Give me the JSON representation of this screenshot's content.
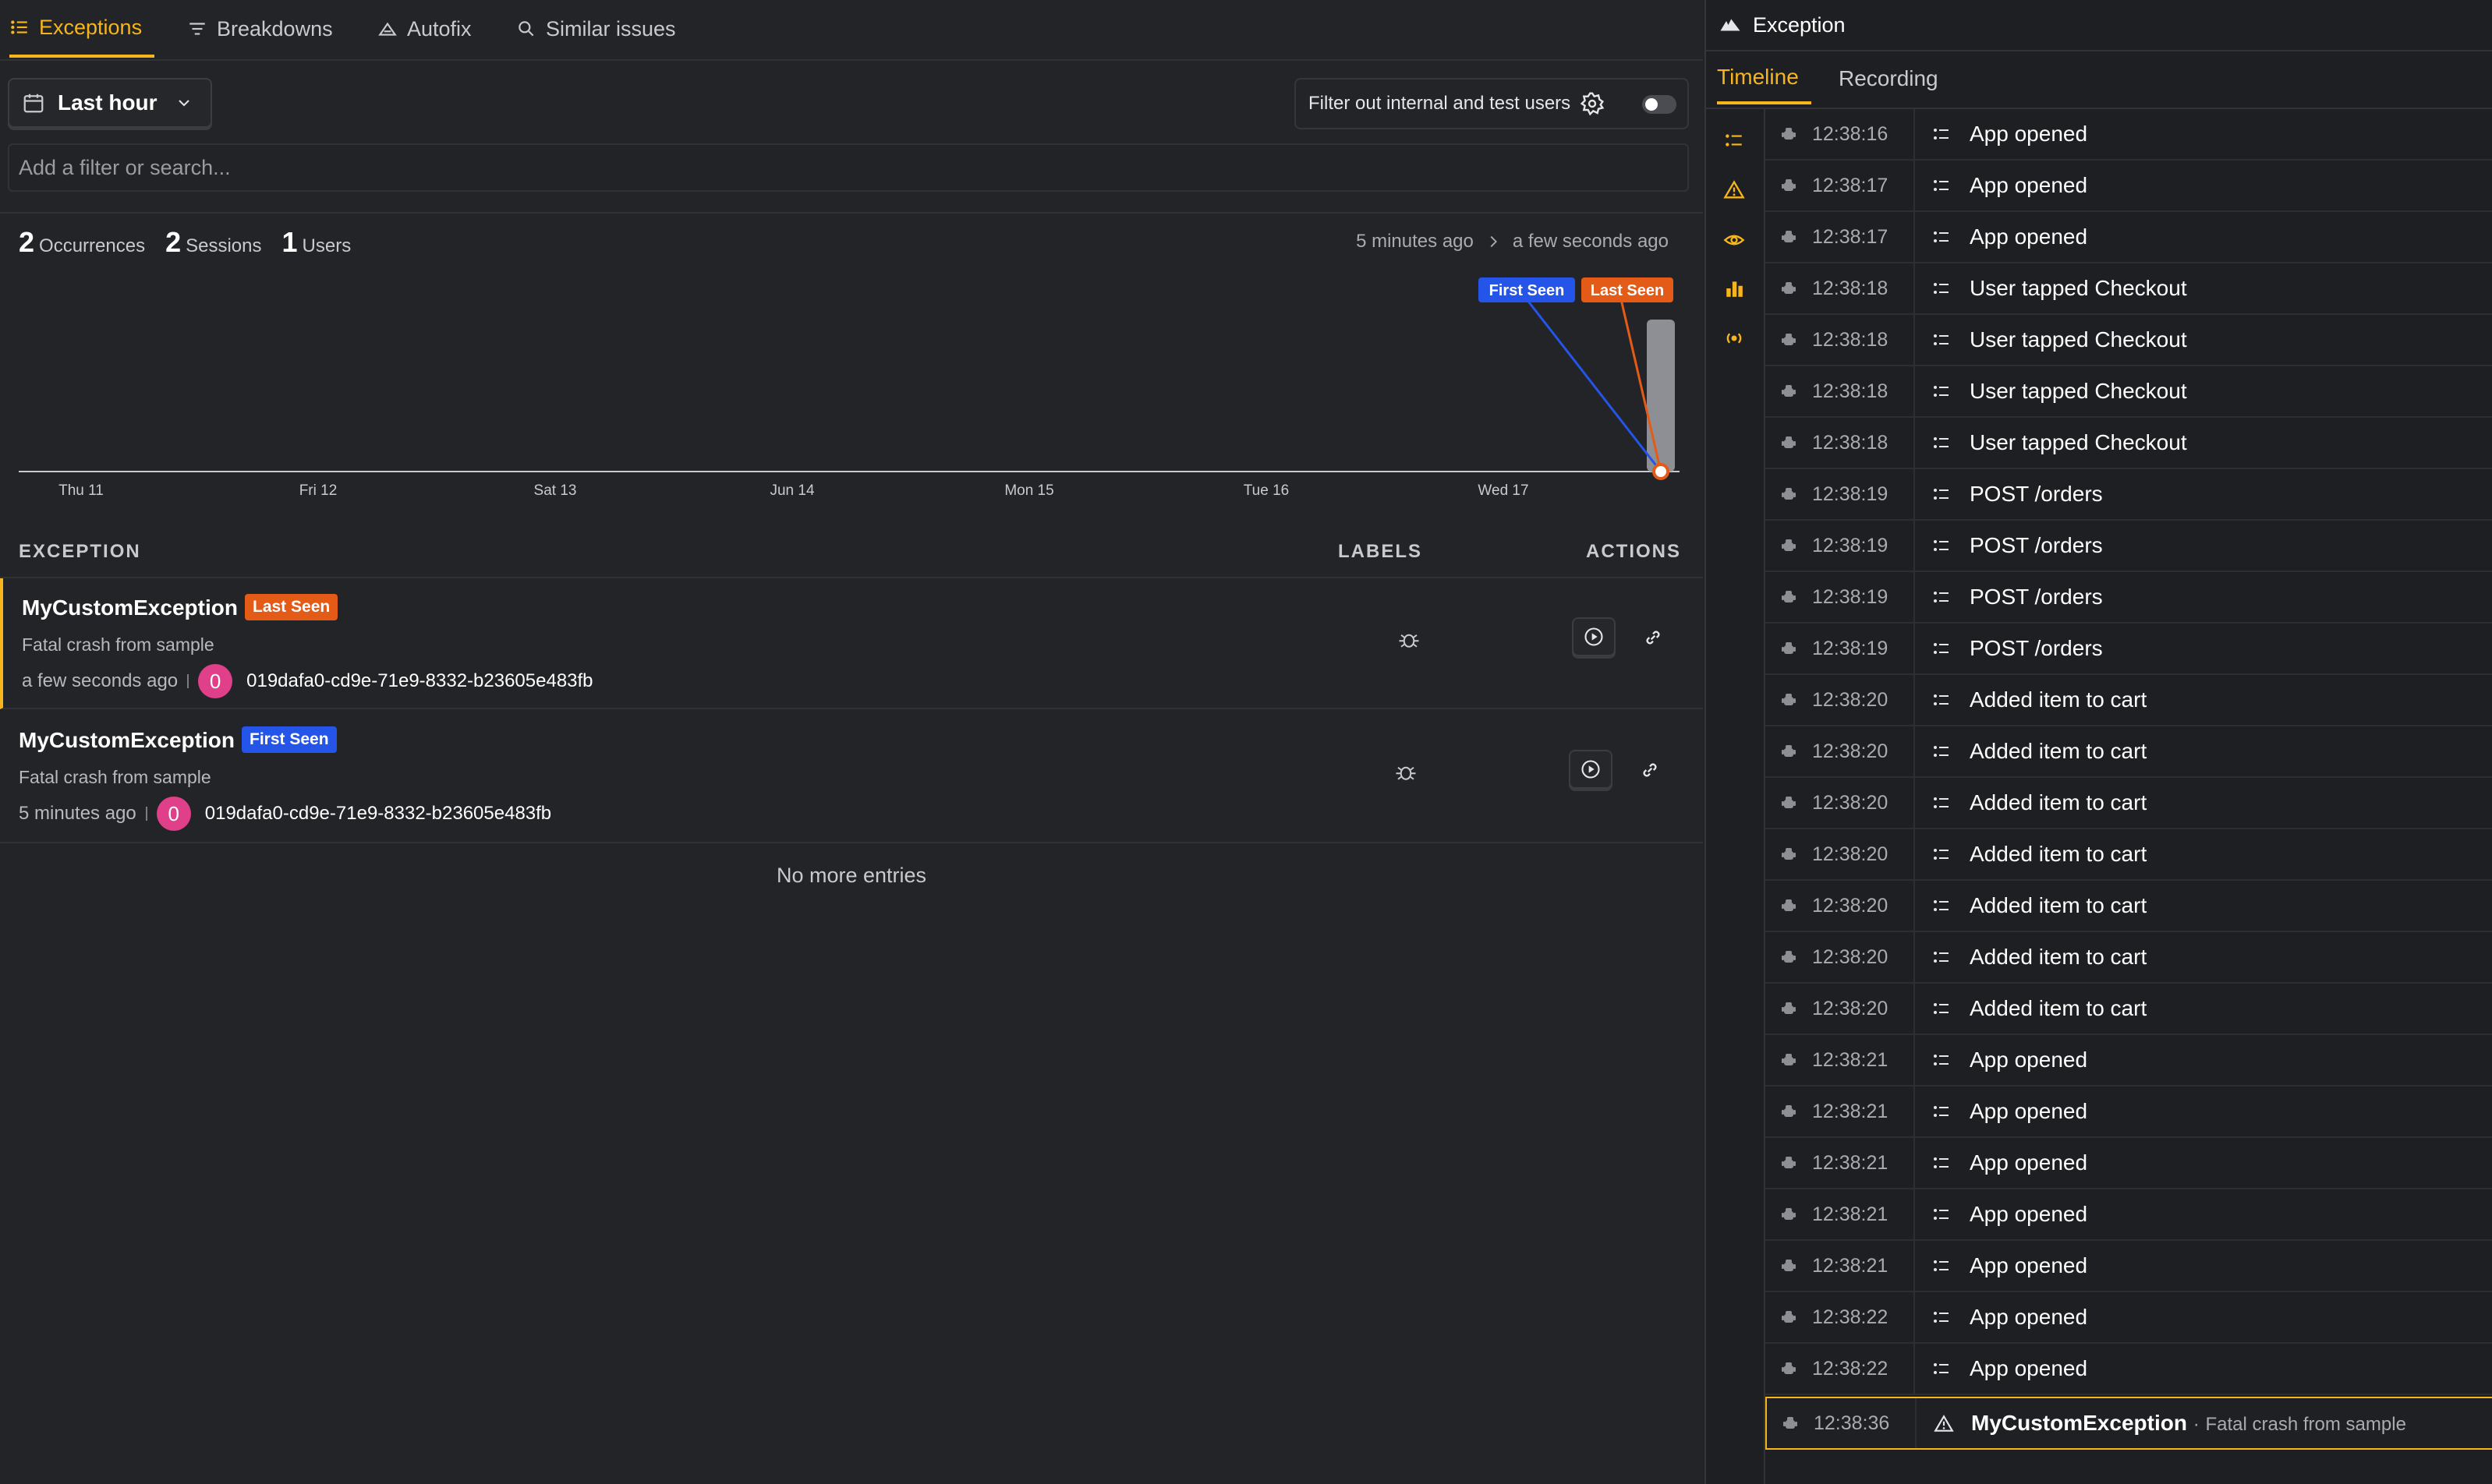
{
  "tabs": [
    {
      "label": "Exceptions",
      "icon": "list-icon",
      "active": true
    },
    {
      "label": "Breakdowns",
      "icon": "filter-lines-icon"
    },
    {
      "label": "Autofix",
      "icon": "robot-icon"
    },
    {
      "label": "Similar issues",
      "icon": "search-icon"
    }
  ],
  "toolbar": {
    "date_range": "Last hour",
    "internal_filter_label": "Filter out internal and test users",
    "internal_filter_enabled": false,
    "search_placeholder": "Add a filter or search..."
  },
  "stats": {
    "occurrences_count": "2",
    "occurrences_label": "Occurrences",
    "sessions_count": "2",
    "sessions_label": "Sessions",
    "users_count": "1",
    "users_label": "Users",
    "range_start": "5 minutes ago",
    "range_end": "a few seconds ago"
  },
  "chart_data": {
    "type": "bar",
    "categories": [
      "Thu 11",
      "Fri 12",
      "Sat 13",
      "Jun 14",
      "Mon 15",
      "Tue 16",
      "Wed 17"
    ],
    "x_tick_labels": [
      "Thu 11",
      "Fri 12",
      "Sat 13",
      "Jun 14",
      "Mon 15",
      "Tue 16",
      "Wed 17"
    ],
    "values": [
      0,
      0,
      0,
      0,
      0,
      0,
      2
    ],
    "markers": [
      {
        "label": "First Seen",
        "color": "#2454e8"
      },
      {
        "label": "Last Seen",
        "color": "#e45a17"
      }
    ],
    "bar_color": "#8e8f94",
    "title": "",
    "xlabel": "",
    "ylabel": ""
  },
  "table": {
    "col_exception": "EXCEPTION",
    "col_labels": "LABELS",
    "col_actions": "ACTIONS",
    "rows": [
      {
        "title": "MyCustomException",
        "badge": "Last Seen",
        "badge_color": "#e45a17",
        "description": "Fatal crash from sample",
        "time": "a few seconds ago",
        "count": "0",
        "id": "019dafa0-cd9e-71e9-8332-b23605e483fb"
      },
      {
        "title": "MyCustomException",
        "badge": "First Seen",
        "badge_color": "#2454e8",
        "description": "Fatal crash from sample",
        "time": "5 minutes ago",
        "count": "0",
        "id": "019dafa0-cd9e-71e9-8332-b23605e483fb"
      }
    ],
    "footer": "No more entries"
  },
  "panel": {
    "title": "Exception",
    "tabs": [
      "Timeline",
      "Recording"
    ],
    "rail_icons": [
      "list-icon",
      "warning-icon",
      "eye-icon",
      "bar-chart-icon",
      "broadcast-icon"
    ],
    "timeline": [
      {
        "time": "12:38:16",
        "label": "App opened"
      },
      {
        "time": "12:38:17",
        "label": "App opened"
      },
      {
        "time": "12:38:17",
        "label": "App opened"
      },
      {
        "time": "12:38:18",
        "label": "User tapped Checkout"
      },
      {
        "time": "12:38:18",
        "label": "User tapped Checkout"
      },
      {
        "time": "12:38:18",
        "label": "User tapped Checkout"
      },
      {
        "time": "12:38:18",
        "label": "User tapped Checkout"
      },
      {
        "time": "12:38:19",
        "label": "POST /orders"
      },
      {
        "time": "12:38:19",
        "label": "POST /orders"
      },
      {
        "time": "12:38:19",
        "label": "POST /orders"
      },
      {
        "time": "12:38:19",
        "label": "POST /orders"
      },
      {
        "time": "12:38:20",
        "label": "Added item to cart"
      },
      {
        "time": "12:38:20",
        "label": "Added item to cart"
      },
      {
        "time": "12:38:20",
        "label": "Added item to cart"
      },
      {
        "time": "12:38:20",
        "label": "Added item to cart"
      },
      {
        "time": "12:38:20",
        "label": "Added item to cart"
      },
      {
        "time": "12:38:20",
        "label": "Added item to cart"
      },
      {
        "time": "12:38:20",
        "label": "Added item to cart"
      },
      {
        "time": "12:38:21",
        "label": "App opened"
      },
      {
        "time": "12:38:21",
        "label": "App opened"
      },
      {
        "time": "12:38:21",
        "label": "App opened"
      },
      {
        "time": "12:38:21",
        "label": "App opened"
      },
      {
        "time": "12:38:21",
        "label": "App opened"
      },
      {
        "time": "12:38:22",
        "label": "App opened"
      },
      {
        "time": "12:38:22",
        "label": "App opened"
      }
    ],
    "exception_event": {
      "time": "12:38:36",
      "label": "MyCustomException",
      "separator": "·",
      "sub": "Fatal crash from sample"
    }
  },
  "colors": {
    "accent": "#f7b51d",
    "first_seen": "#2454e8",
    "last_seen": "#e45a17"
  }
}
